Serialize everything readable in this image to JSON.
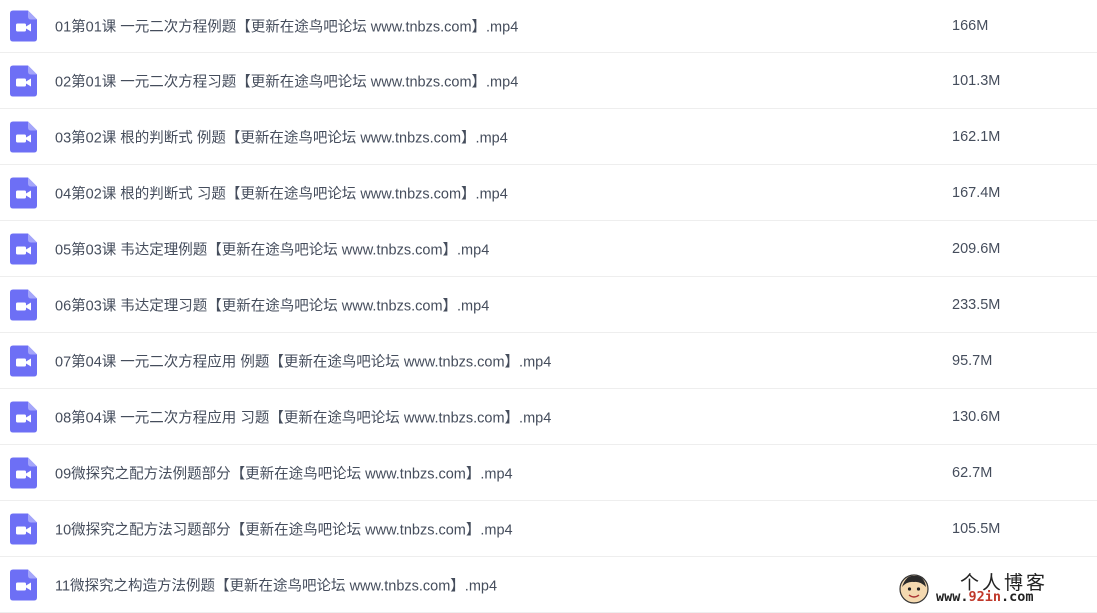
{
  "icons": {
    "file": "video-file-icon",
    "accent": "#6d6ff5"
  },
  "files": [
    {
      "name": "01第01课 一元二次方程例题【更新在途鸟吧论坛 www.tnbzs.com】.mp4",
      "size": "166M"
    },
    {
      "name": "02第01课 一元二次方程习题【更新在途鸟吧论坛 www.tnbzs.com】.mp4",
      "size": "101.3M"
    },
    {
      "name": "03第02课 根的判断式 例题【更新在途鸟吧论坛 www.tnbzs.com】.mp4",
      "size": "162.1M"
    },
    {
      "name": "04第02课 根的判断式 习题【更新在途鸟吧论坛 www.tnbzs.com】.mp4",
      "size": "167.4M"
    },
    {
      "name": "05第03课 韦达定理例题【更新在途鸟吧论坛 www.tnbzs.com】.mp4",
      "size": "209.6M"
    },
    {
      "name": "06第03课 韦达定理习题【更新在途鸟吧论坛 www.tnbzs.com】.mp4",
      "size": "233.5M"
    },
    {
      "name": "07第04课 一元二次方程应用 例题【更新在途鸟吧论坛 www.tnbzs.com】.mp4",
      "size": "95.7M"
    },
    {
      "name": "08第04课 一元二次方程应用 习题【更新在途鸟吧论坛 www.tnbzs.com】.mp4",
      "size": "130.6M"
    },
    {
      "name": "09微探究之配方法例题部分【更新在途鸟吧论坛 www.tnbzs.com】.mp4",
      "size": "62.7M"
    },
    {
      "name": "10微探究之配方法习题部分【更新在途鸟吧论坛 www.tnbzs.com】.mp4",
      "size": "105.5M"
    },
    {
      "name": "11微探究之构造方法例题【更新在途鸟吧论坛 www.tnbzs.com】.mp4",
      "size": ""
    }
  ],
  "watermark": {
    "title": "个人博客",
    "url_prefix": "www.",
    "url_domain": "92in",
    "url_suffix": ".com"
  }
}
